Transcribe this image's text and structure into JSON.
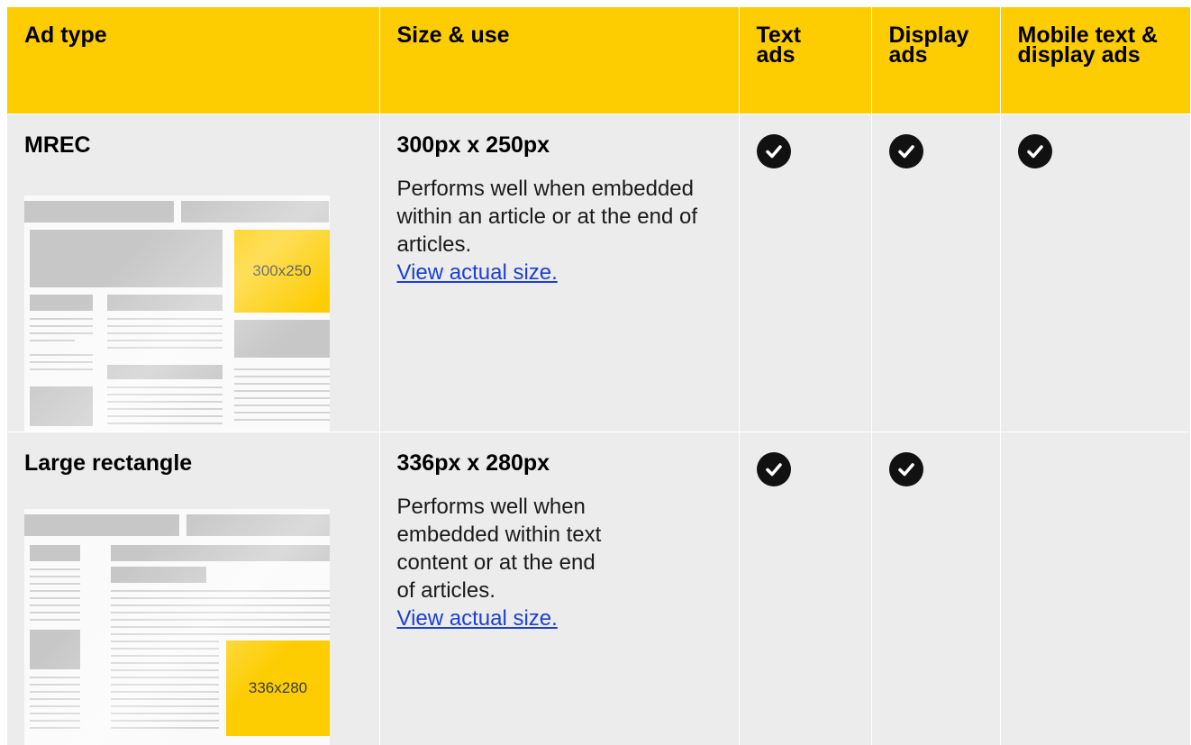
{
  "header": {
    "col_ad_type": "Ad type",
    "col_size_use": "Size & use",
    "col_text_ads": "Text ads",
    "col_display_ads": "Display ads",
    "col_mobile": "Mobile text & display ads"
  },
  "rows": [
    {
      "name": "MREC",
      "size": "300px x 250px",
      "description": "Performs well when embedded within an article or at the end of articles.",
      "link": "View actual size.",
      "thumb_label": "300x250",
      "text_ads": true,
      "display_ads": true,
      "mobile": true
    },
    {
      "name": "Large rectangle",
      "size": "336px x 280px",
      "description": "Performs well when embedded within text content or at the end of articles.",
      "link": "View actual size.",
      "thumb_label": "336x280",
      "text_ads": true,
      "display_ads": true,
      "mobile": false
    }
  ],
  "icons": {
    "check": "check-circle-icon"
  },
  "colors": {
    "accent_yellow": "#fdcd01",
    "row_bg": "#ececec",
    "link": "#1a3fd6"
  }
}
